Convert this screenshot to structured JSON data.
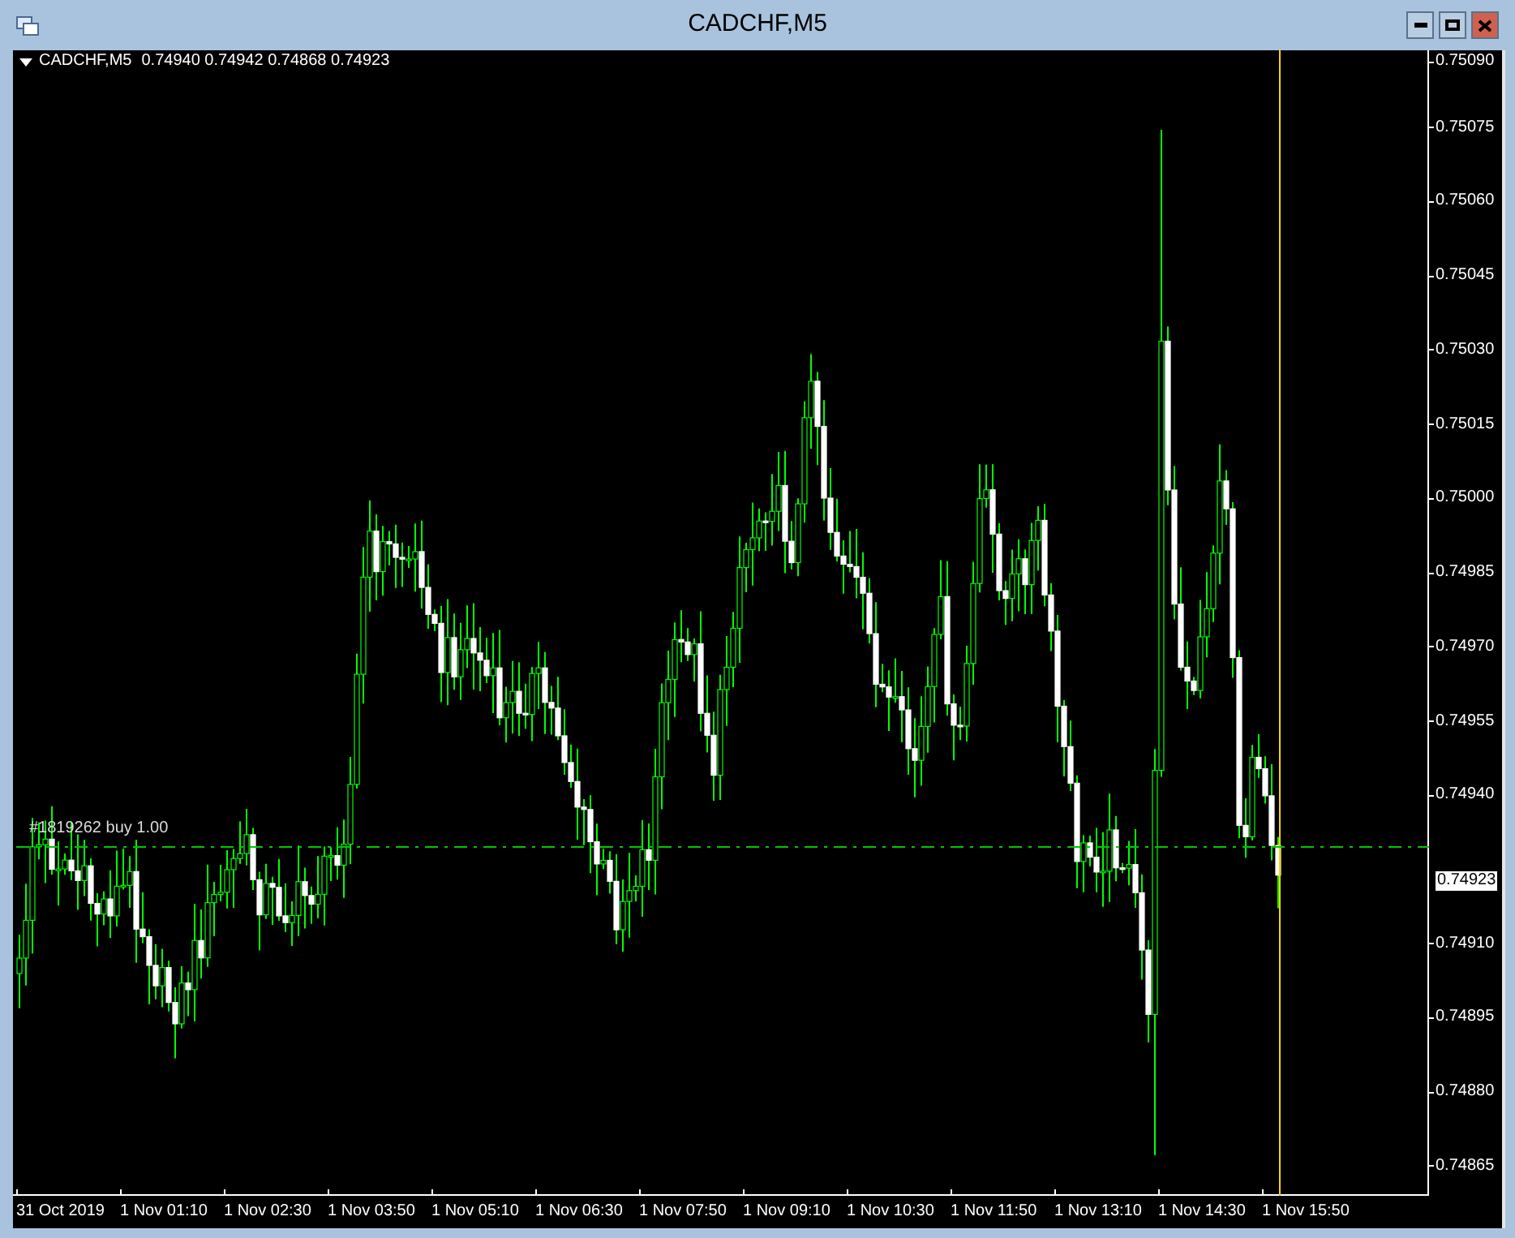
{
  "window": {
    "title": "CADCHF,M5"
  },
  "chart": {
    "symbol": "CADCHF,M5",
    "ohlc": "0.74940 0.74942 0.74868 0.74923",
    "order_line": {
      "label": "#1819262 buy 1.00"
    },
    "current_price": "0.74923",
    "price_axis": [
      "0.75090",
      "0.75075",
      "0.75060",
      "0.75045",
      "0.75030",
      "0.75015",
      "0.75000",
      "0.74985",
      "0.74970",
      "0.74955",
      "0.74940",
      "0.74910",
      "0.74895",
      "0.74880",
      "0.74865"
    ],
    "time_axis": [
      "31 Oct 2019",
      "1 Nov 01:10",
      "1 Nov 02:30",
      "1 Nov 03:50",
      "1 Nov 05:10",
      "1 Nov 06:30",
      "1 Nov 07:50",
      "1 Nov 09:10",
      "1 Nov 10:30",
      "1 Nov 11:50",
      "1 Nov 13:10",
      "1 Nov 14:30",
      "1 Nov 15:50"
    ]
  }
}
